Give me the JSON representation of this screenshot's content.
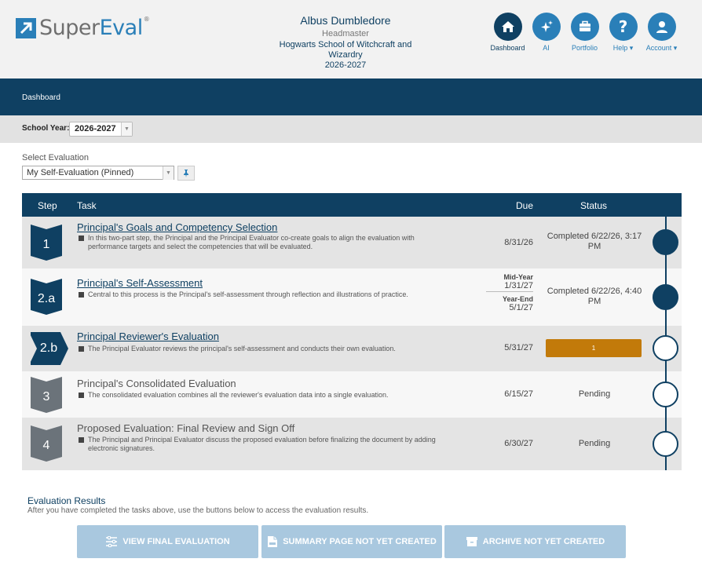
{
  "header": {
    "logo": {
      "part1": "Super",
      "part2": "Eval",
      "tm": "®"
    },
    "user": {
      "name": "Albus Dumbledore",
      "role": "Headmaster",
      "school": "Hogwarts School of Witchcraft and Wizardry",
      "year": "2026-2027"
    },
    "nav": [
      {
        "label": "Dashboard",
        "icon": "home-icon",
        "active": true
      },
      {
        "label": "AI",
        "icon": "sparkle-icon"
      },
      {
        "label": "Portfolio",
        "icon": "briefcase-icon"
      },
      {
        "label": "Help ▾",
        "icon": "question-icon"
      },
      {
        "label": "Account ▾",
        "icon": "user-icon"
      }
    ]
  },
  "banner": {
    "label": "Dashboard"
  },
  "school_year": {
    "label": "School Year:",
    "value": "2026-2027"
  },
  "select_evaluation": {
    "label": "Select Evaluation",
    "value": "My Self-Evaluation (Pinned)"
  },
  "table": {
    "headers": {
      "step": "Step",
      "task": "Task",
      "due": "Due",
      "status": "Status"
    },
    "rows": [
      {
        "step": "1",
        "title": "Principal's Goals and Competency Selection",
        "desc": "In this two-part step, the Principal and the Principal Evaluator co-create goals to align the evaluation with performance targets and select the competencies that will be evaluated.",
        "due": "8/31/26",
        "status": "Completed 6/22/26, 3:17 PM"
      },
      {
        "step": "2.a",
        "title": "Principal's Self-Assessment",
        "desc": "Central to this process is the Principal's self-assessment through reflection and illustrations of practice.",
        "due_mid_label": "Mid-Year",
        "due_mid": "1/31/27",
        "due_end_label": "Year-End",
        "due_end": "5/1/27",
        "status": "Completed 6/22/26, 4:40 PM"
      },
      {
        "step": "2.b",
        "title": "Principal Reviewer's Evaluation",
        "desc": "The Principal Evaluator reviews the principal's self-assessment and conducts their own evaluation.",
        "due": "5/31/27",
        "progress_label": "1"
      },
      {
        "step": "3",
        "title": "Principal's Consolidated Evaluation",
        "desc": "The consolidated evaluation combines all the reviewer's evaluation data into a single evaluation.",
        "due": "6/15/27",
        "status": "Pending"
      },
      {
        "step": "4",
        "title": "Proposed Evaluation: Final Review and Sign Off",
        "desc": "The Principal and Principal Evaluator discuss the proposed evaluation before finalizing the document by adding electronic signatures.",
        "due": "6/30/27",
        "status": "Pending"
      }
    ]
  },
  "results": {
    "title": "Evaluation Results",
    "subtitle": "After you have completed the tasks above, use the buttons below to access the evaluation results.",
    "buttons": {
      "final": "VIEW FINAL EVALUATION",
      "summary": "SUMMARY PAGE NOT YET CREATED",
      "archive": "ARCHIVE NOT YET CREATED"
    }
  },
  "colors": {
    "navy": "#0f4062",
    "blue": "#2a7fb8",
    "progress": "#c27a0a",
    "disabled_button": "#a9c8df"
  }
}
